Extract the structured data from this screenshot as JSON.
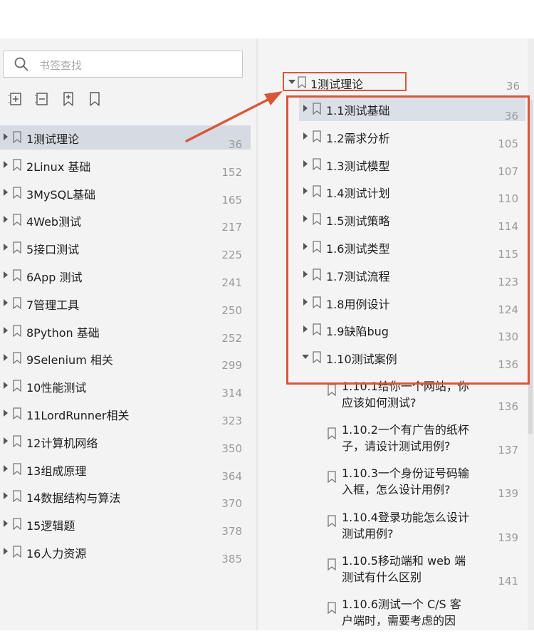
{
  "search": {
    "placeholder": "书签查找"
  },
  "toolbar": [
    {
      "icon": "expand-all-icon"
    },
    {
      "icon": "collapse-all-icon"
    },
    {
      "icon": "add-bookmark-icon"
    },
    {
      "icon": "bookmark-icon"
    }
  ],
  "left_items": [
    {
      "label": "1测试理论",
      "page": "36"
    },
    {
      "label": "2Linux 基础",
      "page": "152"
    },
    {
      "label": "3MySQL基础",
      "page": "165"
    },
    {
      "label": "4Web测试",
      "page": "217"
    },
    {
      "label": "5接口测试",
      "page": "225"
    },
    {
      "label": "6App 测试",
      "page": "241"
    },
    {
      "label": "7管理工具",
      "page": "250"
    },
    {
      "label": "8Python 基础",
      "page": "252"
    },
    {
      "label": "9Selenium 相关",
      "page": "299"
    },
    {
      "label": "10性能测试",
      "page": "314"
    },
    {
      "label": "11LordRunner相关",
      "page": "323"
    },
    {
      "label": "12计算机网络",
      "page": "350"
    },
    {
      "label": "13组成原理",
      "page": "364"
    },
    {
      "label": "14数据结构与算法",
      "page": "370"
    },
    {
      "label": "15逻辑题",
      "page": "378"
    },
    {
      "label": "16人力资源",
      "page": "385"
    }
  ],
  "right_root": {
    "label": "1测试理论",
    "page": "36"
  },
  "right_children": [
    {
      "label": "1.1测试基础",
      "page": "36"
    },
    {
      "label": "1.2需求分析",
      "page": "105"
    },
    {
      "label": "1.3测试模型",
      "page": "107"
    },
    {
      "label": "1.4测试计划",
      "page": "110"
    },
    {
      "label": "1.5测试策略",
      "page": "114"
    },
    {
      "label": "1.6测试类型",
      "page": "115"
    },
    {
      "label": "1.7测试流程",
      "page": "123"
    },
    {
      "label": "1.8用例设计",
      "page": "124"
    },
    {
      "label": "1.9缺陷bug",
      "page": "130"
    },
    {
      "label": "1.10测试案例",
      "page": "136"
    }
  ],
  "right_subitems": [
    {
      "line1": "1.10.1给你一个网站，你",
      "line2": "应该如何测试?",
      "page": "136"
    },
    {
      "line1": "1.10.2一个有广告的纸杯",
      "line2": "子，请设计测试用例?",
      "page": "137"
    },
    {
      "line1": "1.10.3一个身份证号码输",
      "line2": "入框，怎么设计用例?",
      "page": "139"
    },
    {
      "line1": "1.10.4登录功能怎么设计",
      "line2": "测试用例?",
      "page": "139"
    },
    {
      "line1": "1.10.5移动端和 web 端",
      "line2": "测试有什么区别",
      "page": "141"
    },
    {
      "line1": "1.10.6测试一个 C/S 客",
      "line2": "户端时，需要考虑的因",
      "page": ""
    }
  ],
  "colors": {
    "highlight": "#d9563b",
    "selected_left": "#d6dbe3",
    "selected_right": "#dbe0e8"
  }
}
